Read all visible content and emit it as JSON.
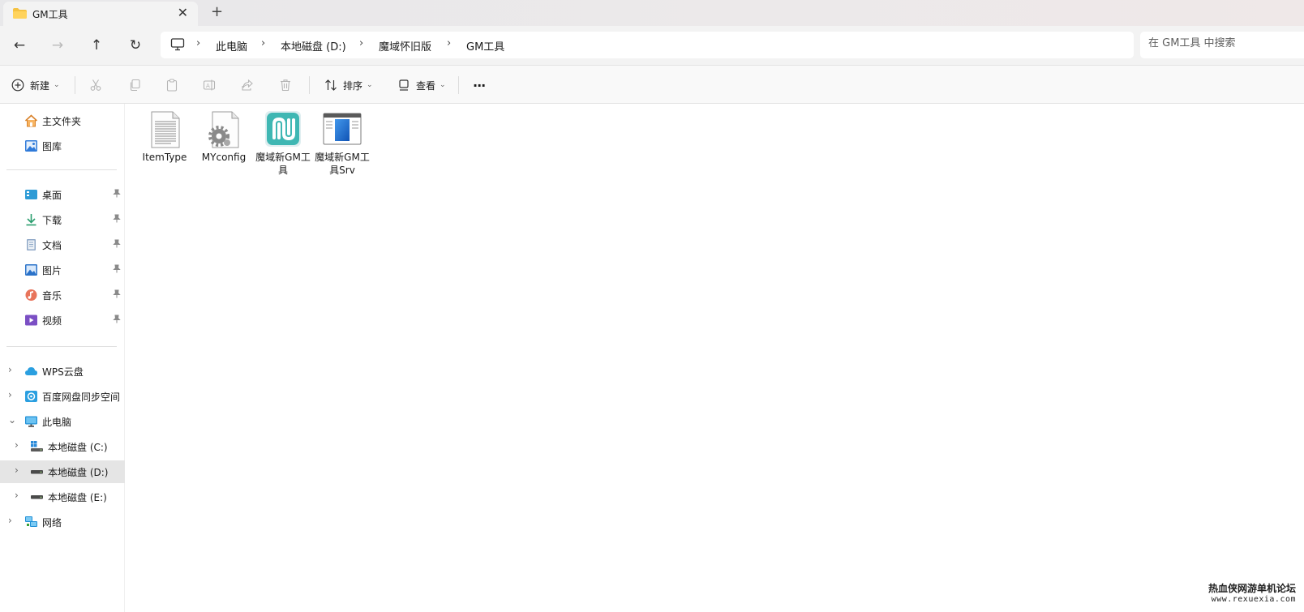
{
  "tab": {
    "title": "GM工具",
    "close_glyph": "✕",
    "new_glyph": "+"
  },
  "nav": {
    "back_glyph": "←",
    "forward_glyph": "→",
    "up_glyph": "↑",
    "refresh_glyph": "↻"
  },
  "breadcrumb": {
    "separator": "›",
    "items": [
      "此电脑",
      "本地磁盘 (D:)",
      "魔域怀旧版",
      "GM工具"
    ]
  },
  "search": {
    "placeholder": "在 GM工具 中搜索"
  },
  "toolbar": {
    "new_label": "新建",
    "sort_label": "排序",
    "view_label": "查看",
    "more_glyph": "···",
    "chevron_glyph": "⌄"
  },
  "sidebar": {
    "pin_glyph": "📌",
    "expand_glyph": "›",
    "collapse_glyph": "⌄",
    "quick": [
      {
        "label": "主文件夹",
        "icon": "home-icon"
      },
      {
        "label": "图库",
        "icon": "gallery-icon"
      }
    ],
    "pinned": [
      {
        "label": "桌面",
        "icon": "desktop-icon"
      },
      {
        "label": "下载",
        "icon": "download-icon"
      },
      {
        "label": "文档",
        "icon": "document-icon"
      },
      {
        "label": "图片",
        "icon": "pictures-icon"
      },
      {
        "label": "音乐",
        "icon": "music-icon"
      },
      {
        "label": "视频",
        "icon": "video-icon"
      }
    ],
    "locations": [
      {
        "label": "WPS云盘",
        "icon": "cloud-icon"
      },
      {
        "label": "百度网盘同步空间",
        "icon": "baidu-sync-icon"
      },
      {
        "label": "此电脑",
        "icon": "computer-icon"
      },
      {
        "label": "本地磁盘 (C:)",
        "icon": "system-drive-icon"
      },
      {
        "label": "本地磁盘 (D:)",
        "icon": "drive-icon",
        "selected": true
      },
      {
        "label": "本地磁盘 (E:)",
        "icon": "drive-icon"
      },
      {
        "label": "网络",
        "icon": "network-icon"
      }
    ]
  },
  "files": [
    {
      "name": "ItemType",
      "icon": "text-file-icon"
    },
    {
      "name": "MYconfig",
      "icon": "config-file-icon"
    },
    {
      "name": "魔域新GM工具",
      "icon": "app-icon"
    },
    {
      "name": "魔域新GM工具Srv",
      "icon": "window-app-icon"
    }
  ],
  "watermark": {
    "line1": "热血侠网游单机论坛",
    "line2": "www.rexuexia.com"
  },
  "colors": {
    "accent": "#0067c0",
    "folder": "#f5c242",
    "selected_bg": "#e5e5e5"
  }
}
